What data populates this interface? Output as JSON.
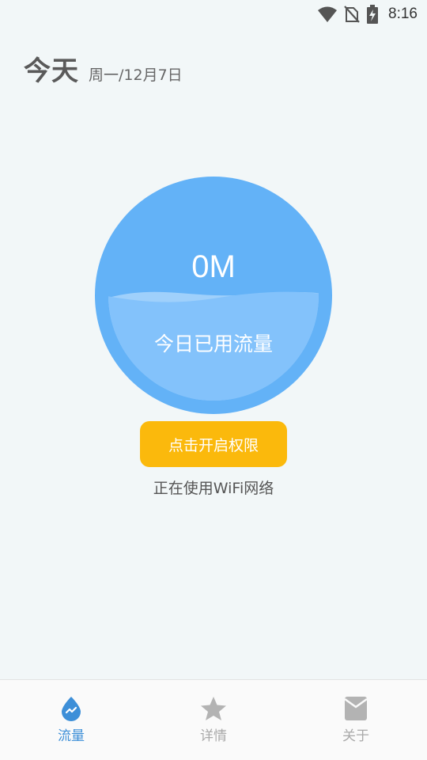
{
  "status_bar": {
    "time": "8:16",
    "icons": [
      "wifi-icon",
      "no-sim-icon",
      "battery-charging-icon"
    ]
  },
  "header": {
    "title": "今天",
    "date": "周一/12月7日"
  },
  "usage": {
    "value": "0M",
    "caption": "今日已用流量",
    "fill_fraction": 0.5
  },
  "permission_button": {
    "label": "点击开启权限"
  },
  "network_status": "正在使用WiFi网络",
  "bottom_nav": {
    "items": [
      {
        "label": "流量",
        "icon": "traffic-drop-icon",
        "active": true
      },
      {
        "label": "详情",
        "icon": "star-icon",
        "active": false
      },
      {
        "label": "关于",
        "icon": "envelope-icon",
        "active": false
      }
    ]
  },
  "colors": {
    "background": "#f2f7f8",
    "circle_outer": "#63b2f7",
    "water": "#83c2fb",
    "button": "#fbb90c",
    "nav_active": "#3d8fd8",
    "nav_inactive": "#a9a9a9"
  }
}
